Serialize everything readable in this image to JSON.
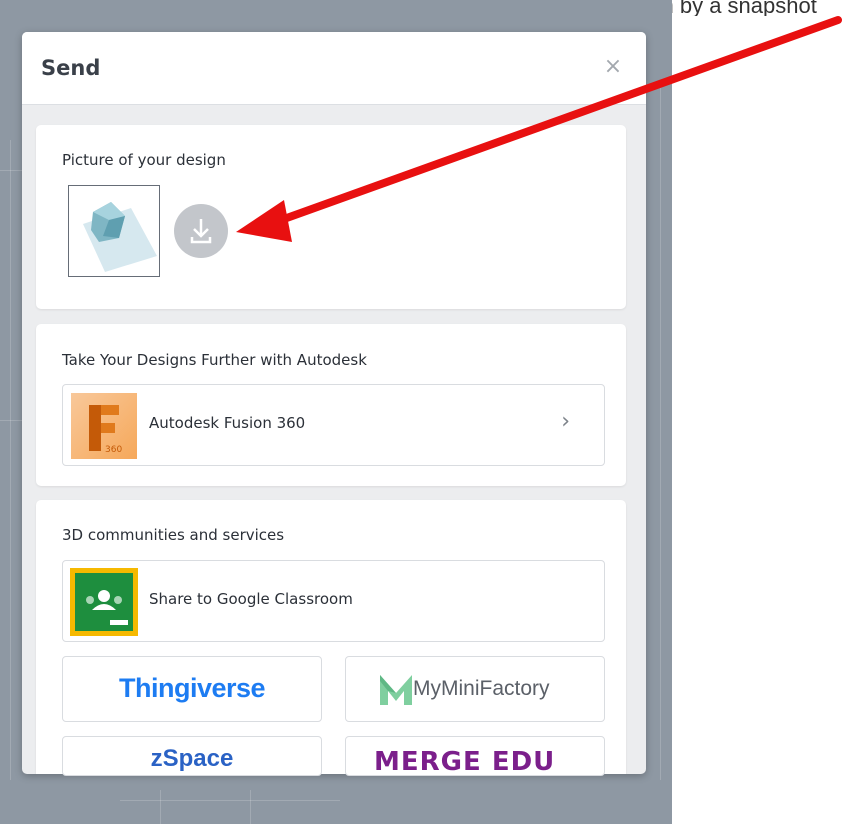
{
  "top_caption": "your design by a snapshot",
  "dialog": {
    "title": "Send",
    "close_glyph": "×"
  },
  "picture_section": {
    "title": "Picture of your design",
    "download_icon": "download-icon"
  },
  "autodesk_section": {
    "title": "Take Your Designs Further with Autodesk",
    "item_label": "Autodesk Fusion 360",
    "item_logo_caption": "360",
    "chevron_glyph": "›"
  },
  "communities_section": {
    "title": "3D communities and services",
    "classroom_label": "Share to Google Classroom",
    "tiles": {
      "thingiverse": "Thingiverse",
      "myminifactory": "MyMiniFactory",
      "zspace": "zSpace",
      "merge": "MERGE",
      "merge_suffix": "EDU"
    }
  },
  "colors": {
    "annotation_arrow": "#e81010",
    "thingiverse_blue": "#1d7cf2",
    "merge_purple": "#7b1f8b",
    "classroom_green": "#1e8e3e",
    "classroom_yellow": "#f6b900"
  }
}
